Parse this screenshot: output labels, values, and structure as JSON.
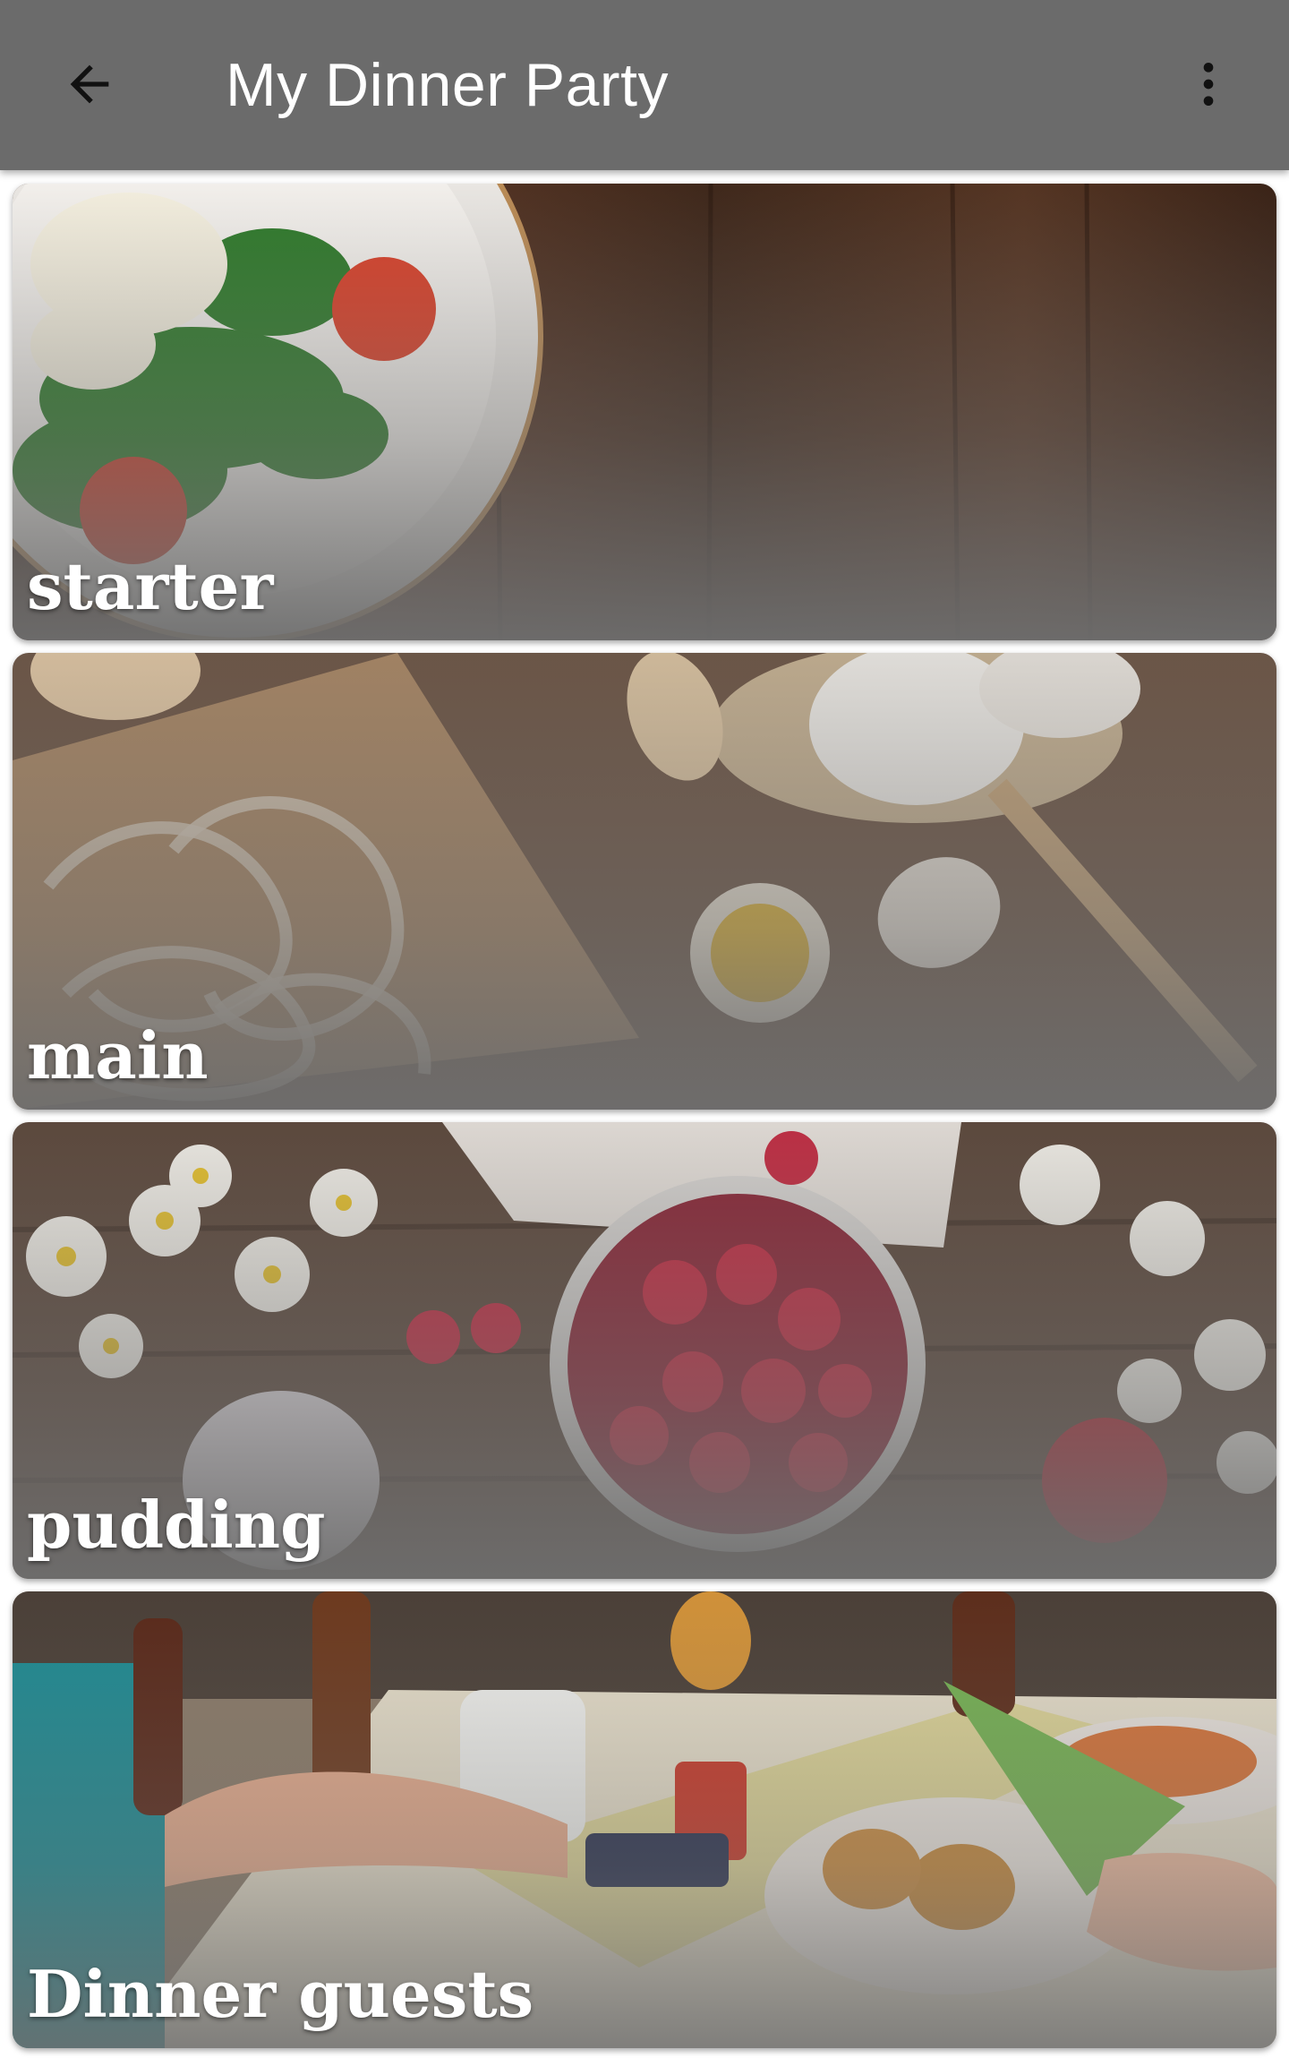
{
  "appbar": {
    "title": "My Dinner Party",
    "back_icon": "arrow-left-icon",
    "menu_icon": "more-vertical-icon"
  },
  "cards": [
    {
      "label": "starter",
      "image": "salad-on-wood-photo"
    },
    {
      "label": "main",
      "image": "pasta-flour-eggs-photo"
    },
    {
      "label": "pudding",
      "image": "raspberries-daisies-photo"
    },
    {
      "label": "Dinner guests",
      "image": "dinner-table-party-photo"
    }
  ],
  "colors": {
    "appbar": "#6b6b6b",
    "title_text": "#ffffff",
    "card_overlay": "#6e6e6e"
  }
}
